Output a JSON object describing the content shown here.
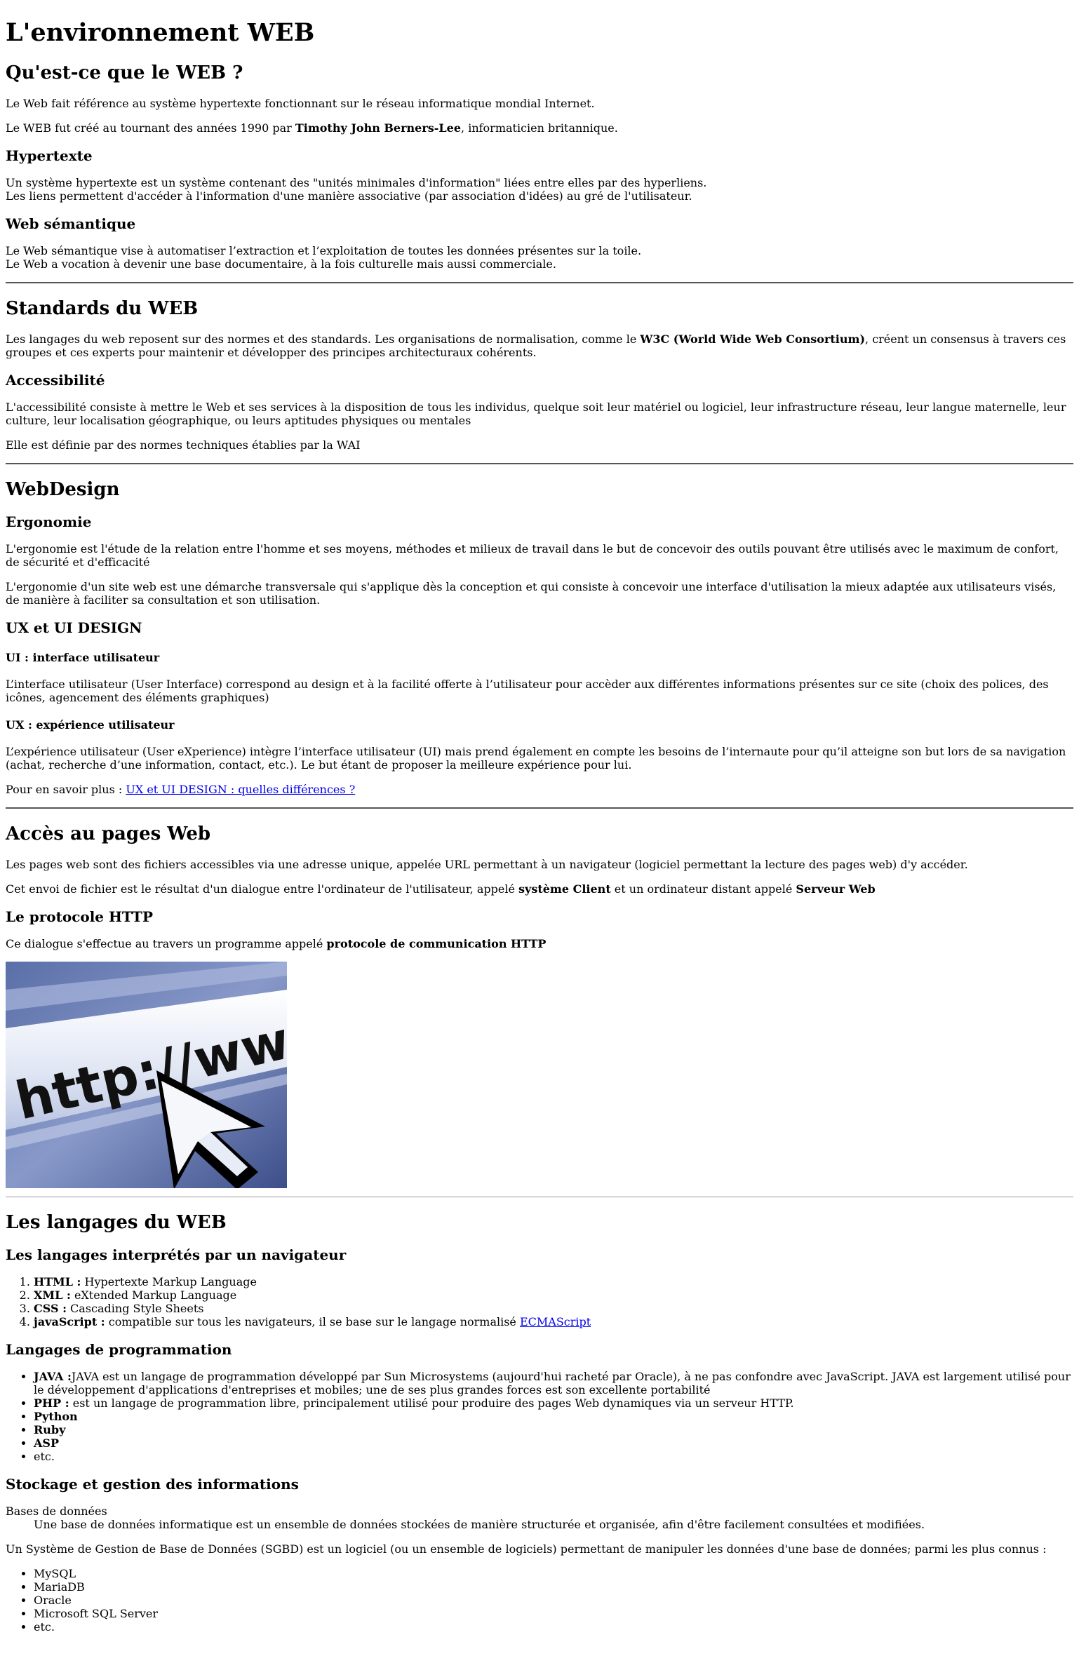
{
  "title": "L'environnement WEB",
  "web": {
    "heading": "Qu'est-ce que le WEB ?",
    "p1": "Le Web fait référence au système hypertexte fonctionnant sur le réseau informatique mondial Internet.",
    "p2_before": "Le WEB fut créé au tournant des années 1990 par ",
    "p2_bold": "Timothy John Berners-Lee",
    "p2_after": ", informaticien britannique.",
    "hypertexte_heading": "Hypertexte",
    "hypertexte_line1": "Un système hypertexte est un système contenant des \"unités minimales d'information\" liées entre elles par des hyperliens.",
    "hypertexte_line2": "Les liens permettent d'accéder à l'information d'une manière associative (par association d'idées) au gré de l'utilisateur.",
    "semantique_heading": "Web sémantique",
    "semantique_line1": "Le Web sémantique vise à automatiser l’extraction et l’exploitation de toutes les données présentes sur la toile.",
    "semantique_line2": "Le Web a vocation à devenir une base documentaire, à la fois culturelle mais aussi commerciale."
  },
  "standards": {
    "heading": "Standards du WEB",
    "p1_before": "Les langages du web reposent sur des normes et des standards. Les organisations de normalisation, comme le ",
    "p1_bold": "W3C (World Wide Web Consortium)",
    "p1_after": ", créent un consensus à travers ces groupes et ces experts pour maintenir et développer des principes architecturaux cohérents.",
    "access_heading": "Accessibilité",
    "access_p1": "L'accessibilité consiste à mettre le Web et ses services à la disposition de tous les individus, quelque soit leur matériel ou logiciel, leur infrastructure réseau, leur langue maternelle, leur culture, leur localisation géographique, ou leurs aptitudes physiques ou mentales",
    "access_p2": "Elle est définie par des normes techniques établies par la WAI"
  },
  "webdesign": {
    "heading": "WebDesign",
    "ergo_heading": "Ergonomie",
    "ergo_p1": "L'ergonomie est l'étude de la relation entre l'homme et ses moyens, méthodes et milieux de travail dans le but de concevoir des outils pouvant être utilisés avec le maximum de confort, de sécurité et d'efficacité",
    "ergo_p2": "L'ergonomie d'un site web est une démarche transversale qui s'applique dès la conception et qui consiste à concevoir une interface d'utilisation la mieux adaptée aux utilisateurs visés, de manière à faciliter sa consultation et son utilisation.",
    "uxui_heading": "UX et UI DESIGN",
    "ui_heading": "UI : interface utilisateur",
    "ui_p": "L’interface utilisateur (User Interface) correspond au design et à la facilité offerte à l’utilisateur pour accèder aux différentes informations présentes sur ce site (choix des polices, des icônes, agencement des éléments graphiques)",
    "ux_heading": "UX : expérience utilisateur",
    "ux_p": "L’expérience utilisateur (User eXperience) intègre l’interface utilisateur (UI) mais prend également en compte les besoins de l’internaute pour qu’il atteigne son but lors de sa navigation (achat, recherche d’une information, contact, etc.). Le but étant de proposer la meilleure expérience pour lui.",
    "more_prefix": "Pour en savoir plus : ",
    "more_link": "UX et UI DESIGN : quelles différences ?"
  },
  "acces": {
    "heading": "Accès au pages Web",
    "p1": "Les pages web sont des fichiers accessibles via une adresse unique, appelée URL permettant à un navigateur (logiciel permettant la lecture des pages web) d'y accéder.",
    "p2_before": "Cet envoi de fichier est le résultat d'un dialogue entre l'ordinateur de l'utilisateur, appelé ",
    "p2_bold1": "système Client",
    "p2_mid": " et un ordinateur distant appelé ",
    "p2_bold2": "Serveur Web",
    "http_heading": "Le protocole HTTP",
    "http_p_before": "Ce dialogue s'effectue au travers un programme appelé ",
    "http_p_bold": "protocole de communication HTTP",
    "image_text": "http://www",
    "image_icon": "cursor-arrow-icon"
  },
  "langages": {
    "heading": "Les langages du WEB",
    "interp_heading": "Les langages interprétés par un navigateur",
    "interp_items": [
      {
        "name": "HTML :",
        "desc": " Hypertexte Markup Language"
      },
      {
        "name": "XML :",
        "desc": " eXtended Markup Language"
      },
      {
        "name": "CSS :",
        "desc": " Cascading Style Sheets"
      },
      {
        "name": "javaScript :",
        "desc": " compatible sur tous les navigateurs, il se base sur le langage normalisé ",
        "link": "ECMAScript"
      }
    ],
    "prog_heading": "Langages de programmation",
    "prog_items": [
      {
        "name": "JAVA :",
        "desc": "JAVA est un langage de programmation développé par Sun Microsystems (aujourd'hui racheté par Oracle), à ne pas confondre avec JavaScript. JAVA est largement utilisé pour le développement d'applications d'entreprises et mobiles; une de ses plus grandes forces est son excellente portabilité"
      },
      {
        "name": "PHP :",
        "desc": " est un langage de programmation libre, principalement utilisé pour produire des pages Web dynamiques via un serveur HTTP."
      },
      {
        "name": "Python",
        "desc": ""
      },
      {
        "name": "Ruby",
        "desc": ""
      },
      {
        "name": "ASP",
        "desc": ""
      },
      {
        "name": "",
        "desc": "etc."
      }
    ],
    "stock_heading": "Stockage et gestion des informations",
    "db_term": "Bases de données",
    "db_def": "Une base de données informatique est un ensemble de données stockées de manière structurée et organisée, afin d'être facilement consultées et modifiées.",
    "sgbd_p": "Un Système de Gestion de Base de Données (SGBD) est un logiciel (ou un ensemble de logiciels) permettant de manipuler les données d'une base de données; parmi les plus connus :",
    "sgbd_items": [
      "MySQL",
      "MariaDB",
      "Oracle",
      "Microsoft SQL Server",
      "etc."
    ]
  }
}
